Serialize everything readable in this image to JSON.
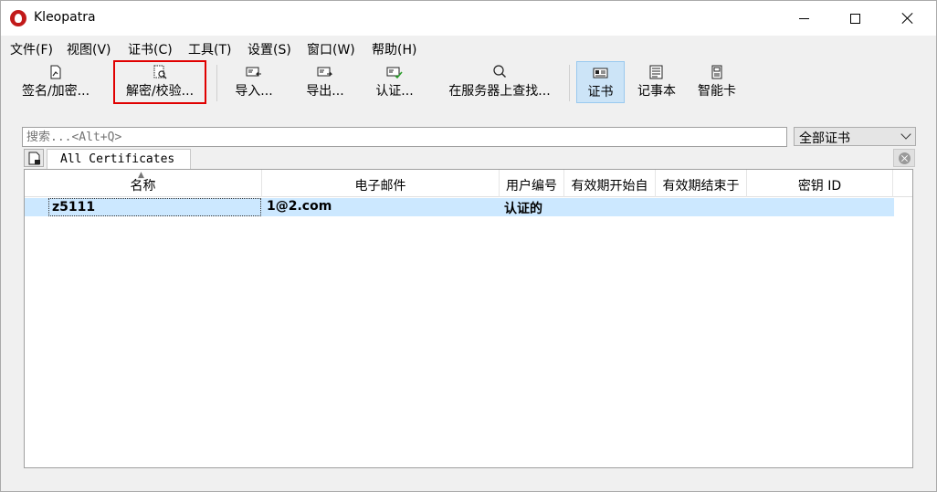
{
  "window": {
    "title": "Kleopatra"
  },
  "menu": [
    "文件(F)",
    "视图(V)",
    "证书(C)",
    "工具(T)",
    "设置(S)",
    "窗口(W)",
    "帮助(H)"
  ],
  "toolbar": {
    "sign_encrypt": "签名/加密...",
    "decrypt_verify": "解密/校验...",
    "import": "导入...",
    "export": "导出...",
    "certify": "认证...",
    "lookup_server": "在服务器上查找...",
    "certificates": "证书",
    "notepad": "记事本",
    "smartcards": "智能卡"
  },
  "search": {
    "placeholder": "搜索...<Alt+Q>"
  },
  "filter": {
    "selected": "全部证书"
  },
  "tabs": [
    {
      "label": "All Certificates"
    }
  ],
  "table": {
    "columns": [
      "名称",
      "电子邮件",
      "用户编号",
      "有效期开始自",
      "有效期结束于",
      "密钥 ID"
    ],
    "rows": [
      {
        "name": "z5111",
        "email": "1@2.com",
        "user_id": "认证的",
        "valid_from": "",
        "valid_until": "",
        "key_id": ""
      }
    ]
  }
}
